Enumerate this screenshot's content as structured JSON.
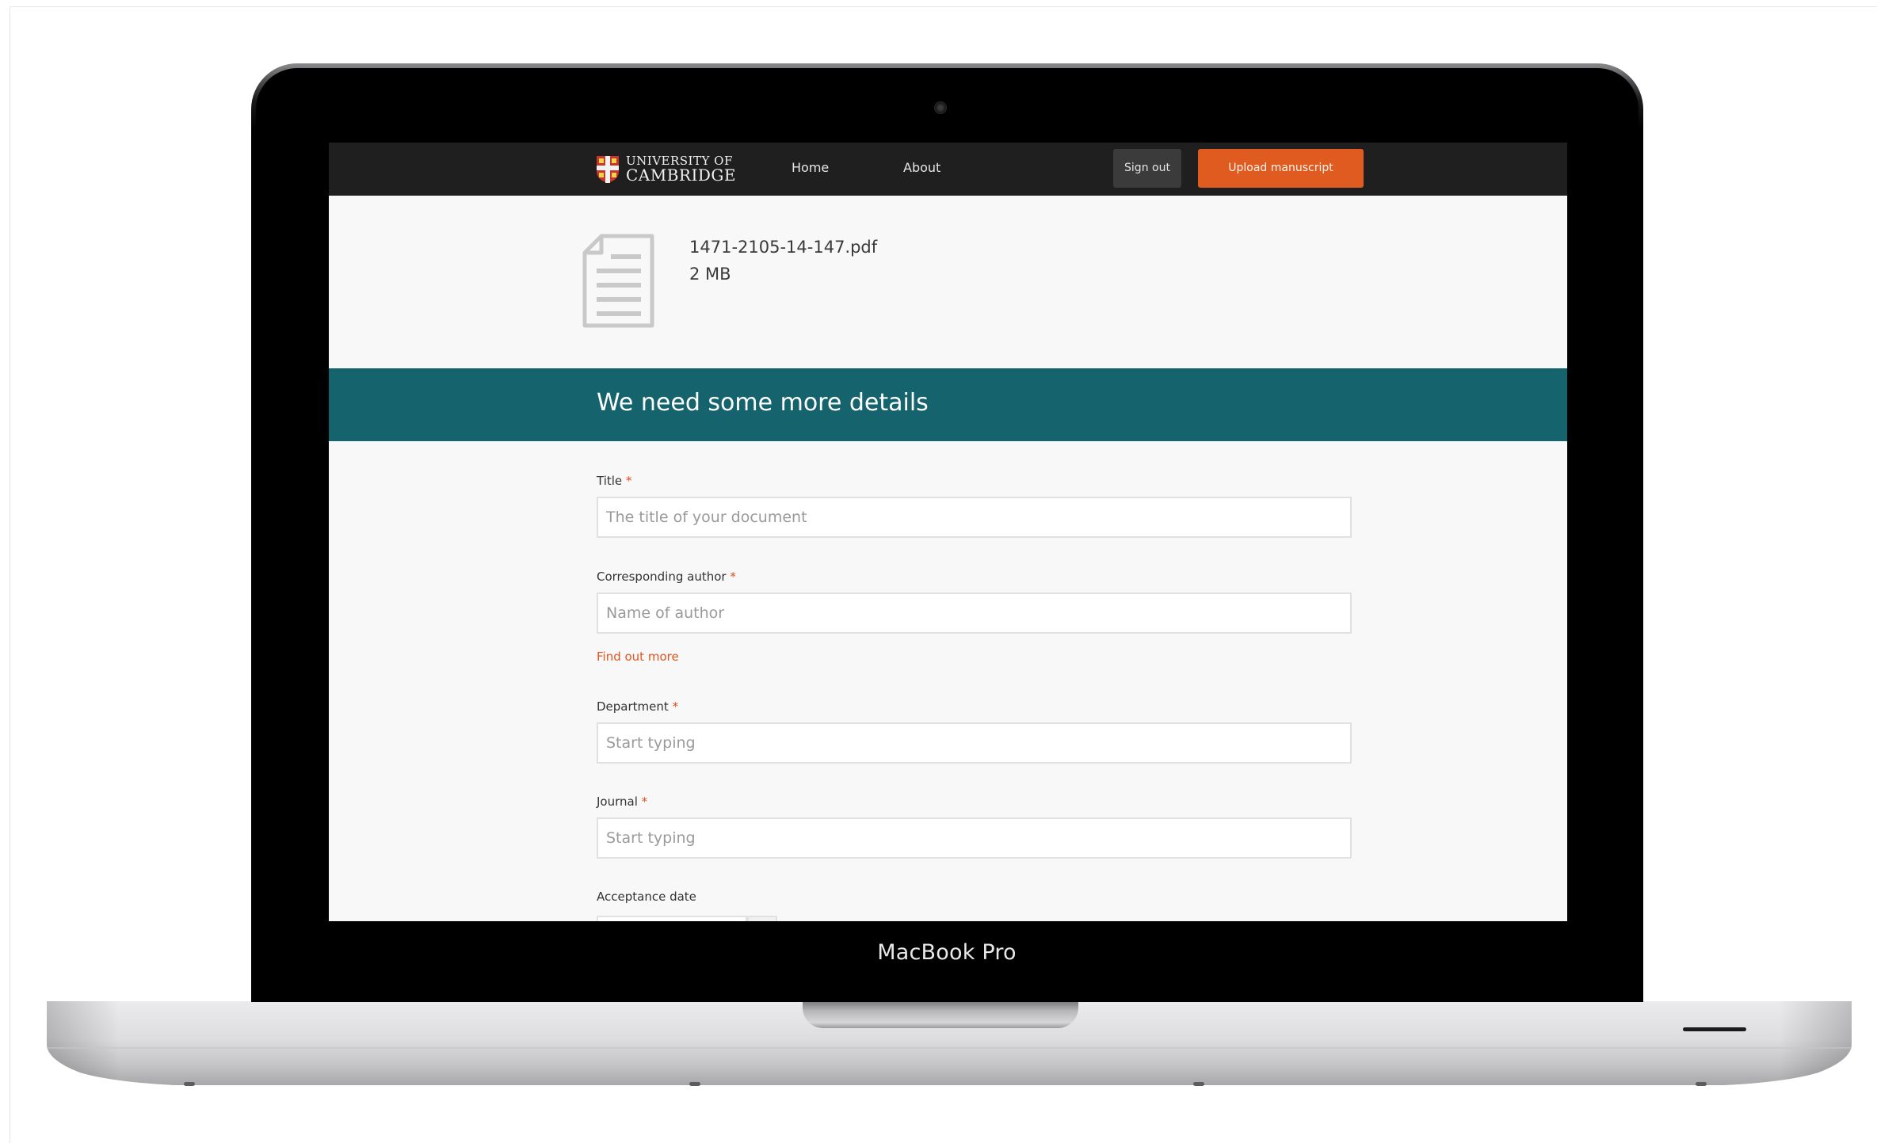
{
  "device": {
    "label": "MacBook Pro"
  },
  "navbar": {
    "logo_line1": "UNIVERSITY OF",
    "logo_line2": "CAMBRIDGE",
    "home_label": "Home",
    "about_label": "About",
    "signout_label": "Sign out",
    "upload_label": "Upload manuscript",
    "upload_color": "#df5b1f"
  },
  "file": {
    "icon": "document-icon",
    "name": "1471-2105-14-147.pdf",
    "size": "2 MB"
  },
  "banner": {
    "title": "We need some more details",
    "color": "#14636d"
  },
  "form": {
    "required_marker": "*",
    "title": {
      "label": "Title",
      "placeholder": "The title of your document",
      "value": ""
    },
    "author": {
      "label": "Corresponding author",
      "placeholder": "Name of author",
      "value": ""
    },
    "find_out_more": "Find out more",
    "department": {
      "label": "Department",
      "placeholder": "Start typing",
      "value": ""
    },
    "journal": {
      "label": "Journal",
      "placeholder": "Start typing",
      "value": ""
    },
    "acceptance_date": {
      "label": "Acceptance date"
    }
  }
}
